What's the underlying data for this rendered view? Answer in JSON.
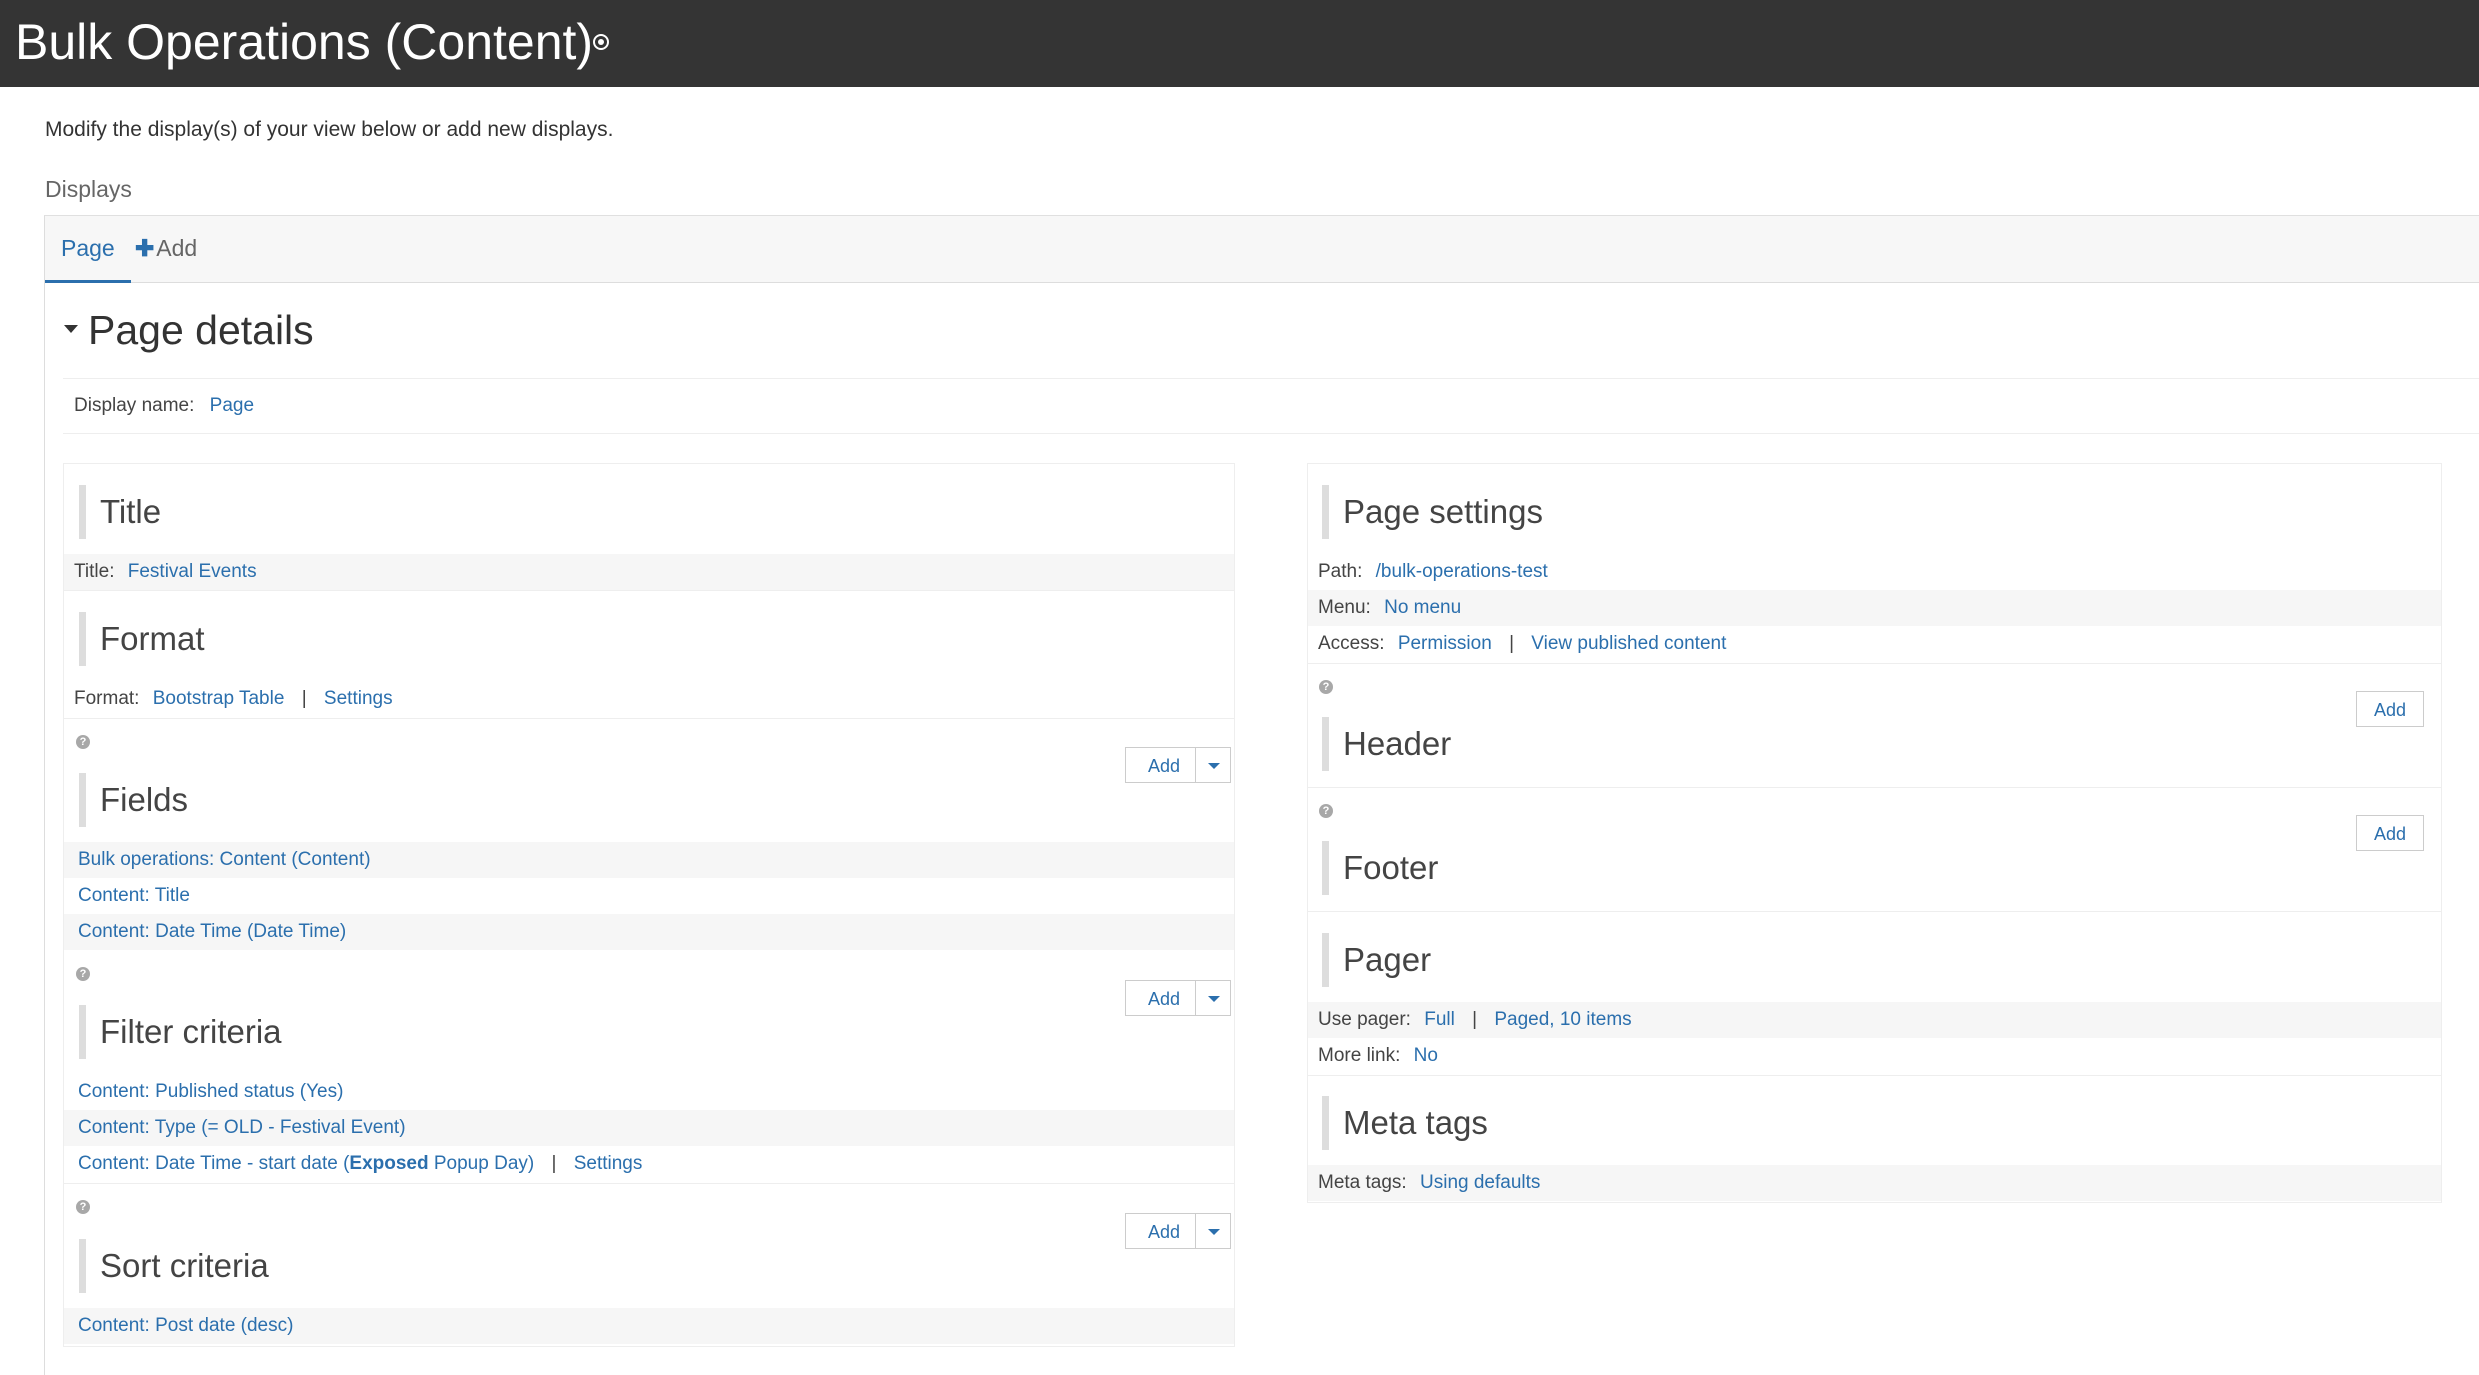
{
  "header": {
    "title": "Bulk Operations (Content)"
  },
  "intro": "Modify the display(s) of your view below or add new displays.",
  "displays_label": "Displays",
  "tabs": {
    "page": "Page",
    "add": "Add"
  },
  "page_details": {
    "heading": "Page details",
    "display_name_label": "Display name:",
    "display_name_value": "Page"
  },
  "left": {
    "title": {
      "heading": "Title",
      "label": "Title:",
      "value": "Festival Events"
    },
    "format": {
      "heading": "Format",
      "label": "Format:",
      "value": "Bootstrap Table",
      "separator": "|",
      "settings": "Settings"
    },
    "fields": {
      "heading": "Fields",
      "add": "Add",
      "items": [
        "Bulk operations: Content (Content)",
        "Content: Title",
        "Content: Date Time (Date Time)"
      ]
    },
    "filter": {
      "heading": "Filter criteria",
      "add": "Add",
      "items": [
        "Content: Published status (Yes)",
        "Content: Type (= OLD - Festival Event)"
      ],
      "last_prefix": "Content: Date Time - start date (",
      "last_exposed": "Exposed",
      "last_suffix": " Popup Day)",
      "separator": "|",
      "settings": "Settings"
    },
    "sort": {
      "heading": "Sort criteria",
      "add": "Add",
      "items": [
        "Content: Post date (desc)"
      ]
    }
  },
  "right": {
    "page_settings": {
      "heading": "Page settings",
      "path_label": "Path:",
      "path_value": "/bulk-operations-test",
      "menu_label": "Menu:",
      "menu_value": "No menu",
      "access_label": "Access:",
      "access_value": "Permission",
      "separator": "|",
      "access_detail": "View published content"
    },
    "header": {
      "heading": "Header",
      "add": "Add"
    },
    "footer": {
      "heading": "Footer",
      "add": "Add"
    },
    "pager": {
      "heading": "Pager",
      "use_pager_label": "Use pager:",
      "use_pager_value": "Full",
      "separator": "|",
      "paged_value": "Paged, 10 items",
      "more_link_label": "More link:",
      "more_link_value": "No"
    },
    "meta": {
      "heading": "Meta tags",
      "label": "Meta tags:",
      "value": "Using defaults"
    }
  },
  "icons": {
    "pin": "pin-icon",
    "help": "help-icon",
    "caret": "caret-down-icon"
  },
  "colors": {
    "topbar": "#343434",
    "link": "#2b6fad"
  }
}
